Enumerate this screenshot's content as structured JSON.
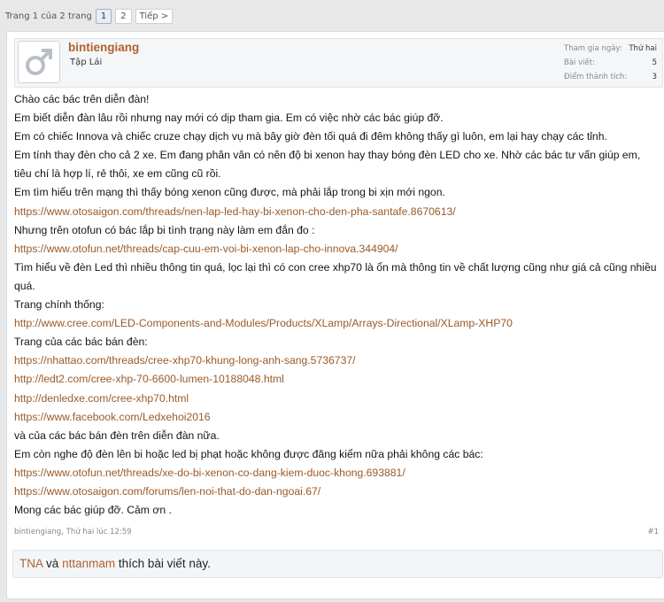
{
  "pagination": {
    "label": "Trang 1 của 2 trang",
    "pages": [
      "1",
      "2"
    ],
    "next": "Tiếp >"
  },
  "author": {
    "avatar_icon": "male-symbol-icon",
    "username": "bintiengiang",
    "title": "Tập Lái",
    "stats": [
      {
        "label": "Tham gia ngày:",
        "value": "Thứ hai"
      },
      {
        "label": "Bài viết:",
        "value": "5"
      },
      {
        "label": "Điểm thành tích:",
        "value": "3"
      }
    ]
  },
  "message": {
    "lines": [
      {
        "text": "Chào các bác trên diễn đàn!",
        "link": false
      },
      {
        "text": "Em biết diễn đàn lâu rồi nhưng nay mới có dịp tham gia. Em có việc nhờ các bác giúp đỡ.",
        "link": false
      },
      {
        "text": "Em có chiếc Innova và chiếc cruze chạy dịch vụ mà bây giờ đèn tối quá đi đêm không thấy gì luôn, em lại hay chạy các tỉnh.",
        "link": false
      },
      {
        "text": "Em tính thay đèn cho cả 2 xe. Em đang phân vân có nên độ bi xenon hay thay bóng đèn LED cho xe. Nhờ các bác tư vấn giúp em, tiêu chí là hợp lí, rẻ thôi, xe em cũng cũ rồi.",
        "link": false
      },
      {
        "text": "Em tìm hiểu trên mạng thì thấy bóng xenon cũng được, mà phải lắp trong bi xịn mới ngon.",
        "link": false
      },
      {
        "text": "https://www.otosaigon.com/threads/nen-lap-led-hay-bi-xenon-cho-den-pha-santafe.8670613/",
        "link": true
      },
      {
        "text": "Nhưng trên otofun có bác lắp bi tình trạng này làm em đắn đo :",
        "link": false
      },
      {
        "text": "https://www.otofun.net/threads/cap-cuu-em-voi-bi-xenon-lap-cho-innova.344904/",
        "link": true
      },
      {
        "text": "Tìm hiểu về đèn Led thì nhiều thông tin quá, lọc lại thì có con cree xhp70 là ổn mà thông tin về chất lượng cũng như giá cả cũng nhiều quá.",
        "link": false
      },
      {
        "text": "Trang chính thống:",
        "link": false
      },
      {
        "text": "http://www.cree.com/LED-Components-and-Modules/Products/XLamp/Arrays-Directional/XLamp-XHP70",
        "link": true
      },
      {
        "text": "Trang của các bác bán đèn:",
        "link": false
      },
      {
        "text": "https://nhattao.com/threads/cree-xhp70-khung-long-anh-sang.5736737/",
        "link": true
      },
      {
        "text": "http://ledt2.com/cree-xhp-70-6600-lumen-10188048.html",
        "link": true
      },
      {
        "text": "http://denledxe.com/cree-xhp70.html",
        "link": true
      },
      {
        "text": "https://www.facebook.com/Ledxehoi2016",
        "link": true
      },
      {
        "text": "và của các bác bán đèn trên diễn đàn nữa.",
        "link": false
      },
      {
        "text": "Em còn nghe độ đèn lên bi hoặc led bị phạt hoặc không được đăng kiểm nữa phải không các bác:",
        "link": false
      },
      {
        "text": "https://www.otofun.net/threads/xe-do-bi-xenon-co-dang-kiem-duoc-khong.693881/",
        "link": true
      },
      {
        "text": "https://www.otosaigon.com/forums/len-noi-that-do-dan-ngoai.67/",
        "link": true
      },
      {
        "text": "Mong các bác giúp đỡ. Cảm ơn .",
        "link": false
      }
    ]
  },
  "meta": {
    "author": "bintiengiang",
    "time": "Thứ hai lúc 12:59",
    "post_number": "#1"
  },
  "likes": {
    "users": [
      "TNA",
      "nttanmam"
    ],
    "conjunction": "và",
    "suffix": "thích bài viết này."
  }
}
